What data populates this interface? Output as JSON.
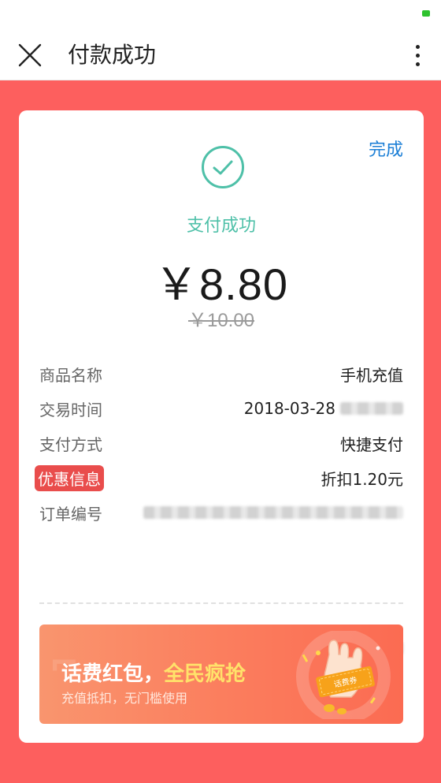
{
  "colors": {
    "page_background": "#fd5f5e",
    "accent_teal": "#4ec0a8",
    "link_blue": "#1c7fd6",
    "badge_red": "#e94d4c"
  },
  "header": {
    "title": "付款成功",
    "close_icon": "close-icon",
    "more_icon": "more-vertical-icon"
  },
  "card": {
    "done_label": "完成",
    "status_icon": "check-circle-icon",
    "status_text": "支付成功",
    "amount": "￥8.80",
    "original_amount": "￥10.00",
    "details": [
      {
        "label": "商品名称",
        "value": "手机充值"
      },
      {
        "label": "交易时间",
        "value": "2018-03-28"
      },
      {
        "label": "支付方式",
        "value": "快捷支付"
      },
      {
        "label": "优惠信息",
        "value": "折扣1.20元"
      },
      {
        "label": "订单编号",
        "value": ""
      }
    ]
  },
  "banner": {
    "title_prefix": "话费红包，",
    "title_highlight": "全民疯抢",
    "subtitle": "充值抵扣，无门槛使用",
    "coupon_text": "话费券"
  }
}
